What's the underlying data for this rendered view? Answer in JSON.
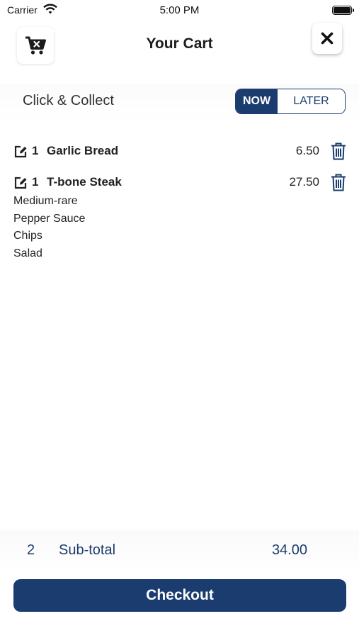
{
  "status_bar": {
    "carrier": "Carrier",
    "time": "5:00 PM",
    "wifi_icon": "wifi-icon",
    "battery_icon": "battery-icon"
  },
  "header": {
    "title": "Your Cart",
    "left_icon": "cart-remove-icon",
    "close_icon": "close-icon"
  },
  "collect": {
    "label": "Click & Collect",
    "options": [
      "NOW",
      "LATER"
    ],
    "selected": "NOW"
  },
  "items": [
    {
      "qty": "1",
      "name": "Garlic Bread",
      "price": "6.50",
      "modifiers": []
    },
    {
      "qty": "1",
      "name": "T-bone Steak",
      "price": "27.50",
      "modifiers": [
        "Medium-rare",
        "Pepper Sauce",
        "Chips",
        "Salad"
      ]
    }
  ],
  "footer": {
    "count": "2",
    "label": "Sub-total",
    "total": "34.00"
  },
  "checkout": {
    "label": "Checkout"
  },
  "colors": {
    "accent": "#1b3c6f",
    "text": "#222222",
    "background": "#ffffff"
  }
}
